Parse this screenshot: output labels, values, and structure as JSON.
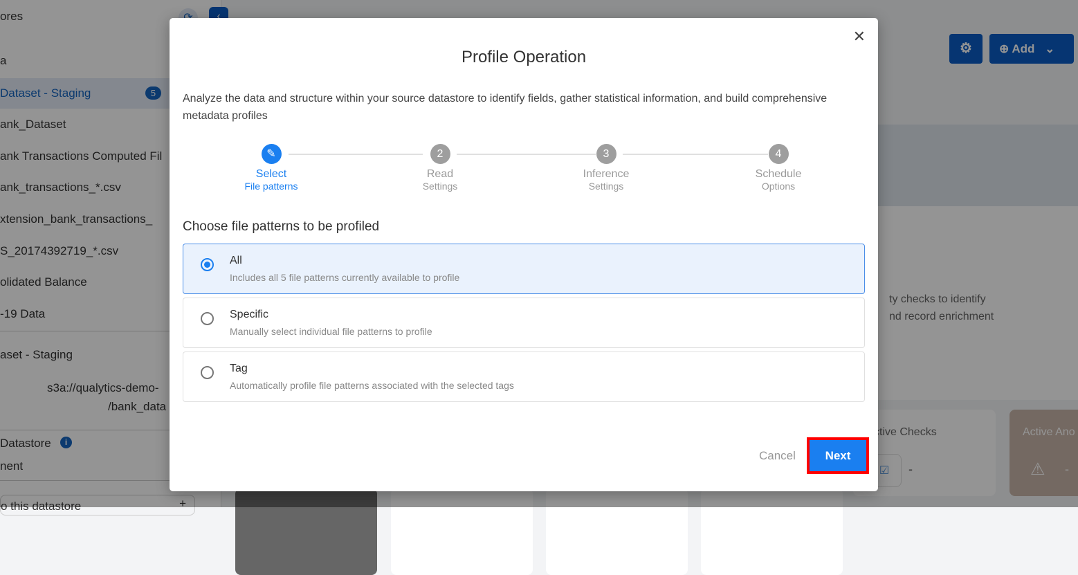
{
  "sidebar": {
    "header": "ores",
    "items": [
      "a",
      "Dataset - Staging",
      "ank_Dataset",
      "ank Transactions Computed Fil",
      "ank_transactions_*.csv",
      "xtension_bank_transactions_",
      "S_20174392719_*.csv",
      "olidated Balance",
      "-19 Data"
    ],
    "active_badge": "5",
    "section_title": "aset - Staging",
    "path_line1": "s3a://qualytics-demo-",
    "path_line2": "/bank_data",
    "datastore_label": "Datastore",
    "datastore_sub": "nent",
    "bottom_text": "o this datastore",
    "bottom_plus": "+"
  },
  "header": {
    "add_label": "Add"
  },
  "background": {
    "desc_line1": "ty checks to identify",
    "desc_line2": "nd record enrichment",
    "card_checks": "ctive Checks",
    "card_checks_value": "-",
    "card_anomalies": "Active Ano",
    "card_anomalies_value": "-"
  },
  "modal": {
    "title": "Profile Operation",
    "description": "Analyze the data and structure within your source datastore to identify fields, gather statistical information, and build comprehensive metadata profiles",
    "steps": [
      {
        "num": "",
        "l1": "Select",
        "l2": "File patterns"
      },
      {
        "num": "2",
        "l1": "Read",
        "l2": "Settings"
      },
      {
        "num": "3",
        "l1": "Inference",
        "l2": "Settings"
      },
      {
        "num": "4",
        "l1": "Schedule",
        "l2": "Options"
      }
    ],
    "choose_label": "Choose file patterns to be profiled",
    "options": [
      {
        "title": "All",
        "desc": "Includes all 5 file patterns currently available to profile",
        "selected": true
      },
      {
        "title": "Specific",
        "desc": "Manually select individual file patterns to profile",
        "selected": false
      },
      {
        "title": "Tag",
        "desc": "Automatically profile file patterns associated with the selected tags",
        "selected": false
      }
    ],
    "cancel": "Cancel",
    "next": "Next"
  },
  "colors": {
    "accent": "#1a7ff0",
    "highlight": "#ff0000"
  }
}
